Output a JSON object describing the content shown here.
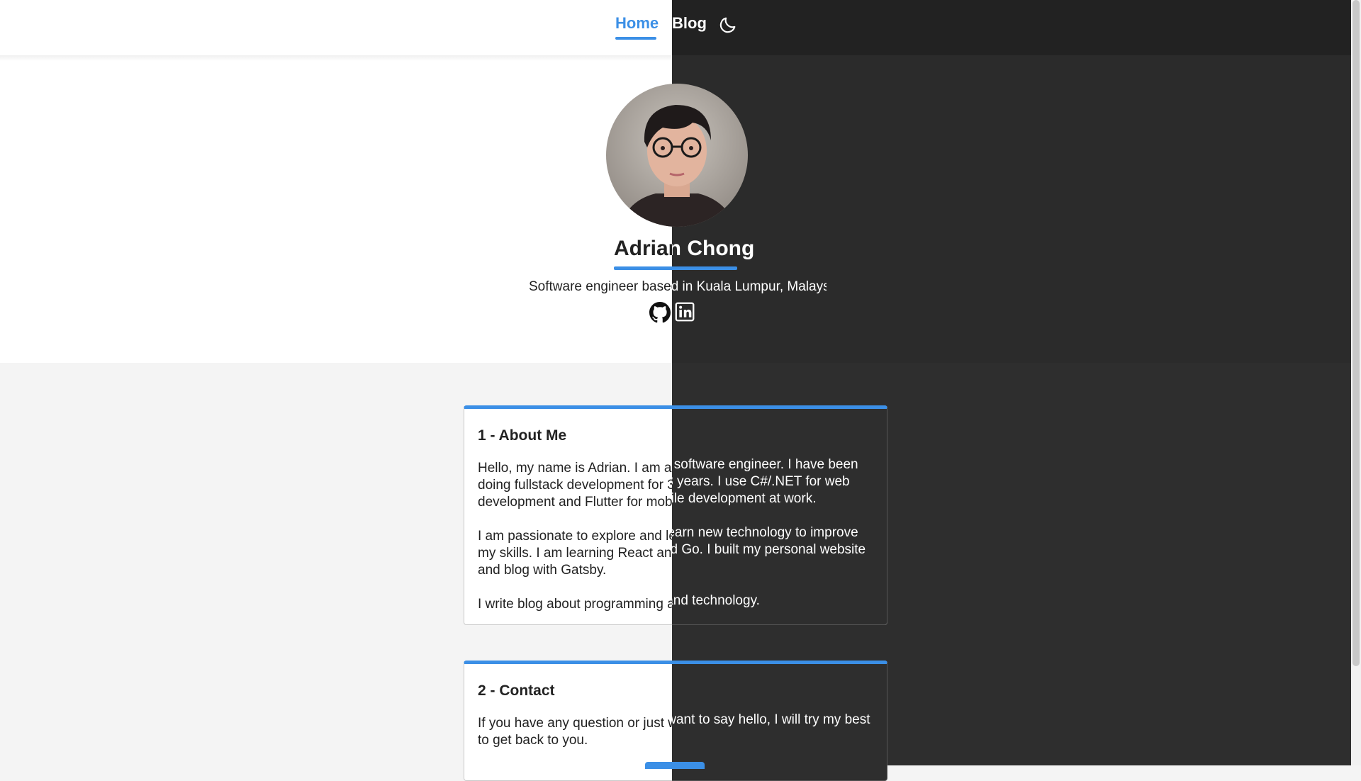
{
  "nav": {
    "home_label": "Home",
    "blog_label": "Blog",
    "theme_toggle_icon": "moon-icon"
  },
  "profile": {
    "name": "Adrian Chong",
    "subtitle": "Software engineer based in Kuala Lumpur, Malaysia.",
    "links": [
      {
        "icon": "github-icon"
      },
      {
        "icon": "linkedin-icon"
      }
    ]
  },
  "sections": [
    {
      "title": "1 - About Me",
      "paragraphs": [
        "Hello, my name is Adrian. I am a software engineer. I have been doing fullstack development for 3 years. I use C#/.NET for web development and Flutter for mobile development at work.",
        "I am passionate to explore and learn new technology to improve my skills. I am learning React and Go. I built my personal website and blog with Gatsby.",
        "I write blog about programming and technology."
      ]
    },
    {
      "title": "2 - Contact",
      "paragraphs": [
        "If you have any question or just want to say hello, I will try my best to get back to you."
      ]
    }
  ],
  "colors": {
    "accent": "#3b8fe6",
    "dark_bg": "#2b2b2b",
    "light_bg": "#ffffff"
  }
}
